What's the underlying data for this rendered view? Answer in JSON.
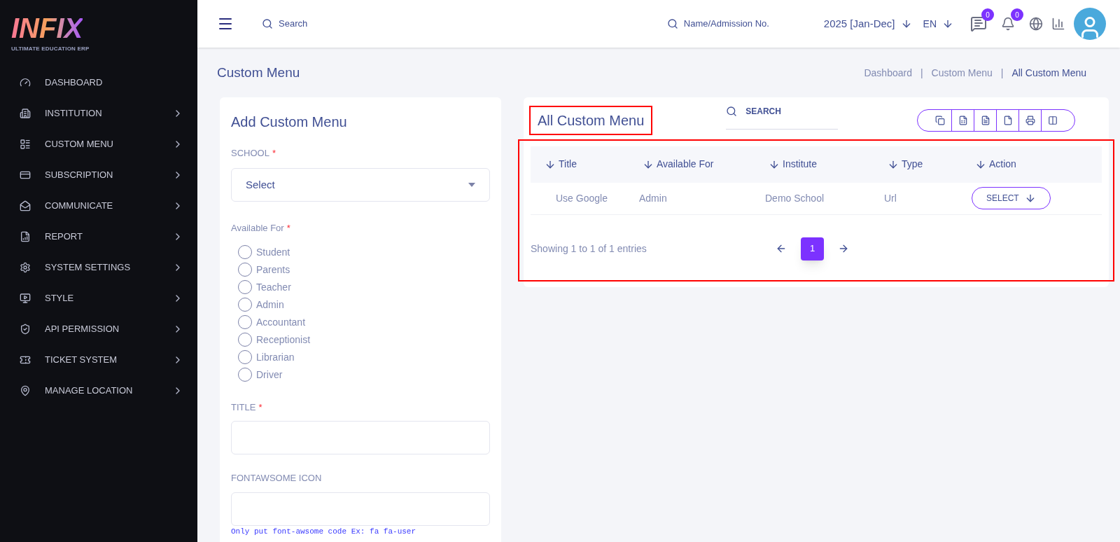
{
  "logo": {
    "name": "INFIX",
    "tagline": "ULTIMATE EDUCATION ERP"
  },
  "sidebar": {
    "items": [
      {
        "label": "DASHBOARD",
        "has_children": false
      },
      {
        "label": "INSTITUTION",
        "has_children": true
      },
      {
        "label": "CUSTOM MENU",
        "has_children": true
      },
      {
        "label": "SUBSCRIPTION",
        "has_children": true
      },
      {
        "label": "COMMUNICATE",
        "has_children": true
      },
      {
        "label": "REPORT",
        "has_children": true
      },
      {
        "label": "SYSTEM SETTINGS",
        "has_children": true
      },
      {
        "label": "STYLE",
        "has_children": true
      },
      {
        "label": "API PERMISSION",
        "has_children": true
      },
      {
        "label": "TICKET SYSTEM",
        "has_children": true
      },
      {
        "label": "MANAGE LOCATION",
        "has_children": true
      }
    ]
  },
  "header": {
    "search_placeholder": "Search",
    "student_search_placeholder": "Name/Admission No.",
    "session": "2025 [Jan-Dec]",
    "language": "EN",
    "message_count": "0",
    "notification_count": "0"
  },
  "page": {
    "title": "Custom Menu",
    "separator": "|",
    "breadcrumbs": [
      "Dashboard",
      "Custom Menu",
      "All Custom Menu"
    ]
  },
  "form": {
    "title": "Add Custom Menu",
    "school_label": "SCHOOL",
    "school_value": "Select",
    "available_label": "Available For",
    "options": [
      {
        "label": "Student",
        "checked": false
      },
      {
        "label": "Parents",
        "checked": false
      },
      {
        "label": "Teacher",
        "checked": false
      },
      {
        "label": "Admin",
        "checked": false
      },
      {
        "label": "Accountant",
        "checked": false
      },
      {
        "label": "Receptionist",
        "checked": false
      },
      {
        "label": "Librarian",
        "checked": false
      },
      {
        "label": "Driver",
        "checked": false
      }
    ],
    "title_label": "TITLE",
    "icon_label": "FONTAWSOME ICON",
    "icon_hint": "Only put font-awsome code Ex: fa fa-user",
    "required_mark": "*"
  },
  "list": {
    "title": "All Custom Menu",
    "search_placeholder": "SEARCH",
    "columns": [
      "Title",
      "Available For",
      "Institute",
      "Type",
      "Action"
    ],
    "rows": [
      {
        "cells": [
          "Use Google",
          "Admin",
          "Demo School",
          "Url"
        ],
        "action": "SELECT"
      }
    ],
    "summary": "Showing 1 to 1 of 1 entries",
    "pages": [
      {
        "label": "1",
        "selected": true
      }
    ]
  }
}
